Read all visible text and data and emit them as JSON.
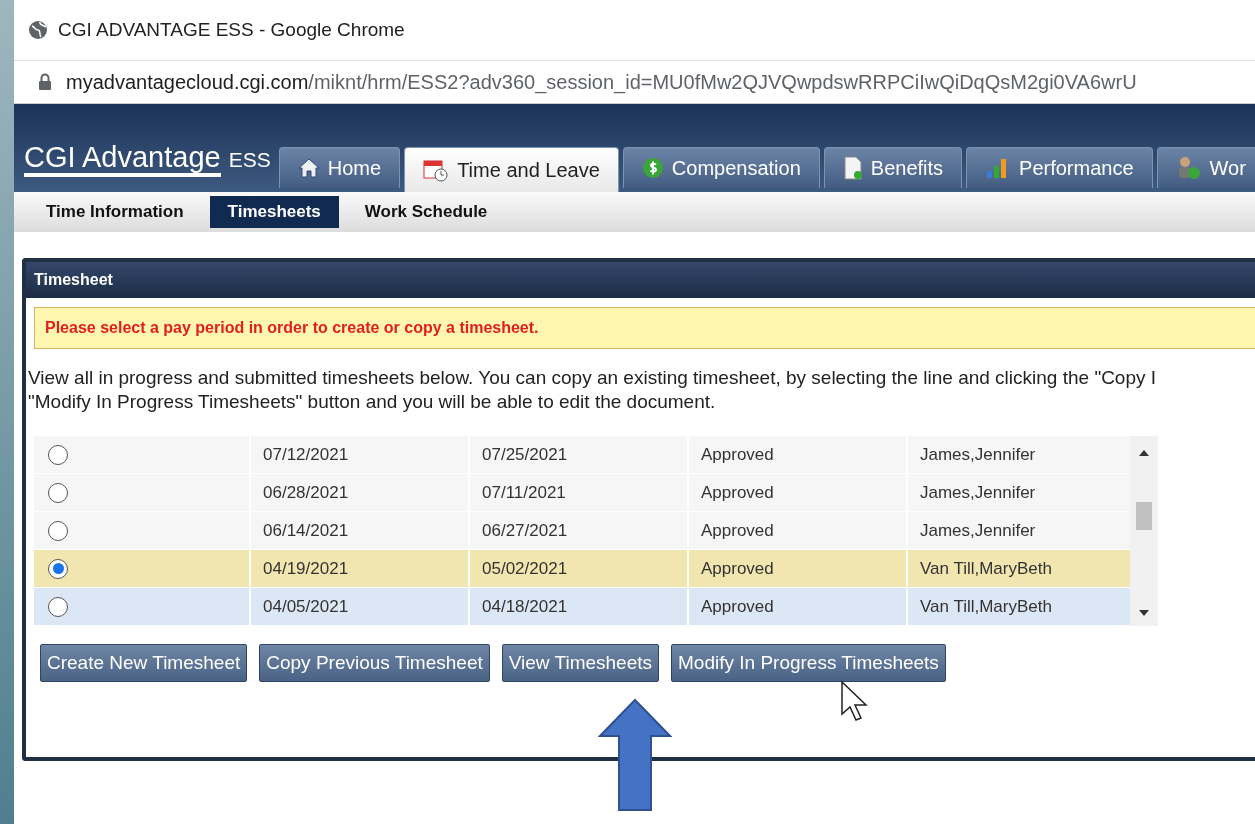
{
  "window": {
    "title": "CGI ADVANTAGE ESS - Google Chrome"
  },
  "address_bar": {
    "domain": "myadvantagecloud.cgi.com",
    "path": "/miknt/hrm/ESS2?adv360_session_id=MU0fMw2QJVQwpdswRRPCiIwQiDqQsM2gi0VA6wrU"
  },
  "header": {
    "logo": "CGI Advantage",
    "logo_suffix": "ESS"
  },
  "tabs": [
    {
      "label": "Home",
      "selected": false
    },
    {
      "label": "Time and Leave",
      "selected": true
    },
    {
      "label": "Compensation",
      "selected": false
    },
    {
      "label": "Benefits",
      "selected": false
    },
    {
      "label": "Performance",
      "selected": false
    },
    {
      "label": "Wor",
      "selected": false
    }
  ],
  "subtabs": [
    {
      "label": "Time Information",
      "selected": false
    },
    {
      "label": "Timesheets",
      "selected": true
    },
    {
      "label": "Work Schedule",
      "selected": false
    }
  ],
  "panel": {
    "title": "Timesheet",
    "warning": "Please select a pay period in order to create or copy a timesheet.",
    "description": "View all in progress and submitted timesheets below. You can copy an existing timesheet, by selecting the line and clicking the \"Copy I",
    "description_2": "\"Modify In Progress Timesheets\" button and you will be able to edit the document."
  },
  "table": {
    "rows": [
      {
        "selected": false,
        "cells": [
          "07/12/2021",
          "07/25/2021",
          "Approved",
          "James,Jennifer"
        ]
      },
      {
        "selected": false,
        "cells": [
          "06/28/2021",
          "07/11/2021",
          "Approved",
          "James,Jennifer"
        ]
      },
      {
        "selected": false,
        "cells": [
          "06/14/2021",
          "06/27/2021",
          "Approved",
          "James,Jennifer"
        ]
      },
      {
        "selected": true,
        "cells": [
          "04/19/2021",
          "05/02/2021",
          "Approved",
          "Van Till,MaryBeth"
        ]
      },
      {
        "selected": false,
        "cells": [
          "04/05/2021",
          "04/18/2021",
          "Approved",
          "Van Till,MaryBeth"
        ]
      }
    ]
  },
  "buttons": [
    "Create New Timesheet",
    "Copy Previous Timesheet",
    "View Timesheets",
    "Modify In Progress Timesheets"
  ]
}
